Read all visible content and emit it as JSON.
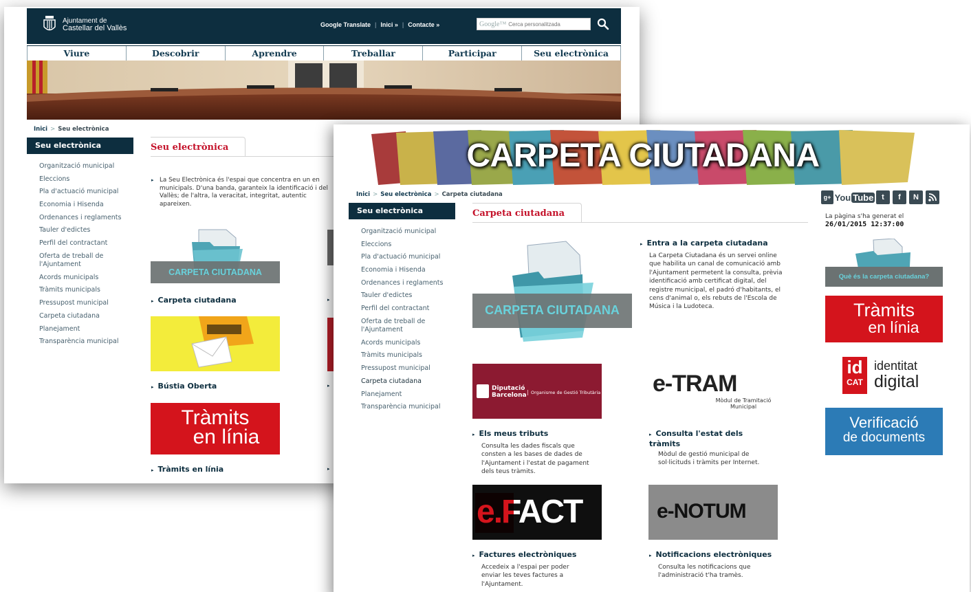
{
  "back": {
    "logo": {
      "line1": "Ajuntament de",
      "line2": "Castellar del Vallès"
    },
    "toplinks": [
      "Google Translate",
      "Inici »",
      "Contacte »"
    ],
    "search": {
      "brand": "Google™",
      "placeholder": "Cerca personalitzada"
    },
    "nav": [
      "Viure",
      "Descobrir",
      "Aprendre",
      "Treballar",
      "Participar",
      "Seu electrònica"
    ],
    "breadcrumb": {
      "home": "Inici",
      "current": "Seu electrònica"
    },
    "sidebar": {
      "title": "Seu electrònica",
      "items": [
        "Organització municipal",
        "Eleccions",
        "Pla d'actuació municipal",
        "Economia i Hisenda",
        "Ordenances i reglaments",
        "Tauler d'edictes",
        "Perfil del contractant",
        "Oferta de treball de l'Ajuntament",
        "Acords municipals",
        "Tràmits municipals",
        "Pressupost municipal",
        "Carpeta ciutadana",
        "Planejament",
        "Transparència municipal"
      ]
    },
    "page_title": "Seu electrònica",
    "intro": "La Seu Electrònica és l'espai que concentra en un en municipals. D'una banda, garanteix la identificació i del Vallès; de l'altra, la veracitat, integritat, autentic apareixen.",
    "tiles": [
      {
        "image_text": "CARPETA CIUTADANA",
        "link": "Carpeta ciutadana"
      },
      {
        "image_text": "",
        "link": "Bústia Oberta"
      },
      {
        "image_text": "Tràmits en línia",
        "link": "Tràmits en línia"
      }
    ]
  },
  "front": {
    "banner_text": "CARPETA CIUTADANA",
    "breadcrumb": {
      "home": "Inici",
      "middle": "Seu electrònica",
      "current": "Carpeta ciutadana"
    },
    "sidebar": {
      "title": "Seu electrònica",
      "items": [
        "Organització municipal",
        "Eleccions",
        "Pla d'actuació municipal",
        "Economia i Hisenda",
        "Ordenances i reglaments",
        "Tauler d'edictes",
        "Perfil del contractant",
        "Oferta de treball de l'Ajuntament",
        "Acords municipals",
        "Tràmits municipals",
        "Pressupost municipal",
        "Carpeta ciutadana",
        "Planejament",
        "Transparència municipal"
      ],
      "active": "Carpeta ciutadana"
    },
    "page_title": "Carpeta ciutadana",
    "main_tile_text": "CARPETA CIUTADANA",
    "enter": {
      "link": "Entra a la carpeta ciutadana",
      "desc": "La Carpeta Ciutadana és un servei online que habilita un canal de comunicació amb l'Ajuntament permetent la consulta, prèvia identificació amb certificat digital, del registre municipal, el padró d'habitants, el cens d'animal o, els rebuts de l'Escola de Música i la Ludoteca."
    },
    "services": [
      {
        "logo_main": "Diputació",
        "logo_sub": "Barcelona",
        "logo_extra": "Organisme de Gestió Tributària",
        "link": "Els meus tributs",
        "desc": "Consulta les dades fiscals que consten a les bases de dades de l'Ajuntament i l'estat de pagament dels teus tràmits."
      },
      {
        "logo_main": "e-TRAM",
        "logo_extra": "Mòdul de Tramitació Municipal",
        "link": "Consulta l'estat dels tràmits",
        "desc": "Mòdul de gestió municipal de sol·licituds i tràmits per Internet."
      },
      {
        "logo_main": "e.FACT",
        "link": "Factures electròniques",
        "desc": "Accedeix a l'espai per poder enviar les teves factures a l'Ajuntament."
      },
      {
        "logo_main": "e-NOTUM",
        "link": "Notificacions electròniques",
        "desc": "Consulta les notificacions que l'administració t'ha tramès."
      }
    ],
    "social": [
      "g+",
      "YouTube",
      "twitter",
      "facebook",
      "N",
      "rss"
    ],
    "generated_label": "La pàgina s'ha generat el",
    "generated_value": "26/01/2015 12:37:00",
    "right_tiles": {
      "que_es": "Què és la carpeta ciutadana?",
      "tramits_1": "Tràmits",
      "tramits_2": "en línia",
      "idcat_1": "id",
      "idcat_2": "CAT",
      "idcat_3": "identitat",
      "idcat_4": "digital",
      "verif_1": "Verificació",
      "verif_2": "de documents"
    }
  },
  "colors": {
    "navy": "#0d2e3f",
    "red": "#c4122a",
    "teal": "#5bb3c2"
  }
}
